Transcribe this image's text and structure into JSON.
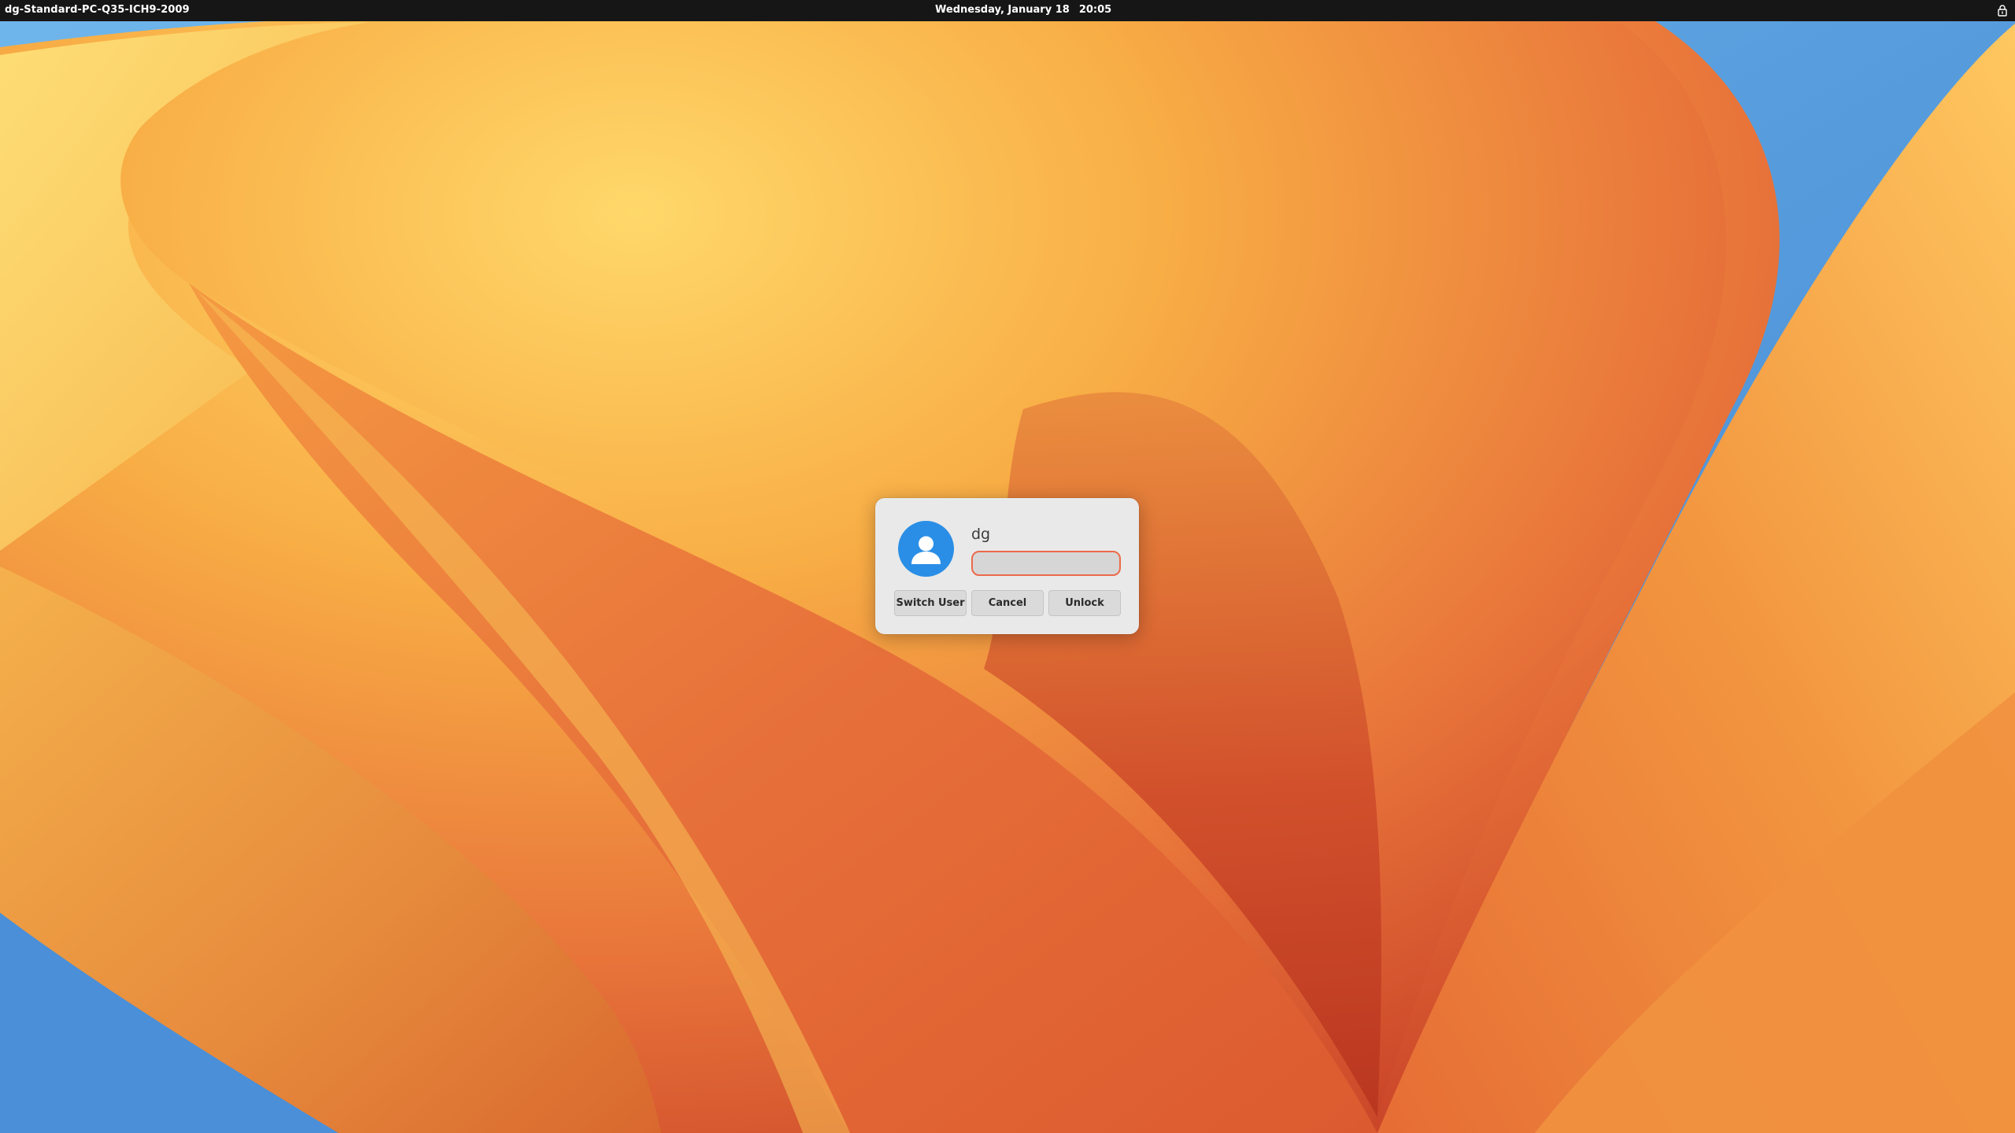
{
  "topbar": {
    "hostname": "dg-Standard-PC-Q35-ICH9-2009",
    "date": "Wednesday, January 18",
    "time": "20:05",
    "lock_icon": "lock-icon"
  },
  "dialog": {
    "avatar_icon": "user-avatar-icon",
    "username": "dg",
    "password": {
      "value": "",
      "placeholder": ""
    },
    "buttons": {
      "switch_user": "Switch User",
      "cancel": "Cancel",
      "unlock": "Unlock"
    }
  },
  "colors": {
    "topbar_bg": "#161616",
    "dialog_bg": "#e9e9e9",
    "avatar_bg": "#2a8ee6",
    "focus_ring": "#ec6a4a"
  }
}
